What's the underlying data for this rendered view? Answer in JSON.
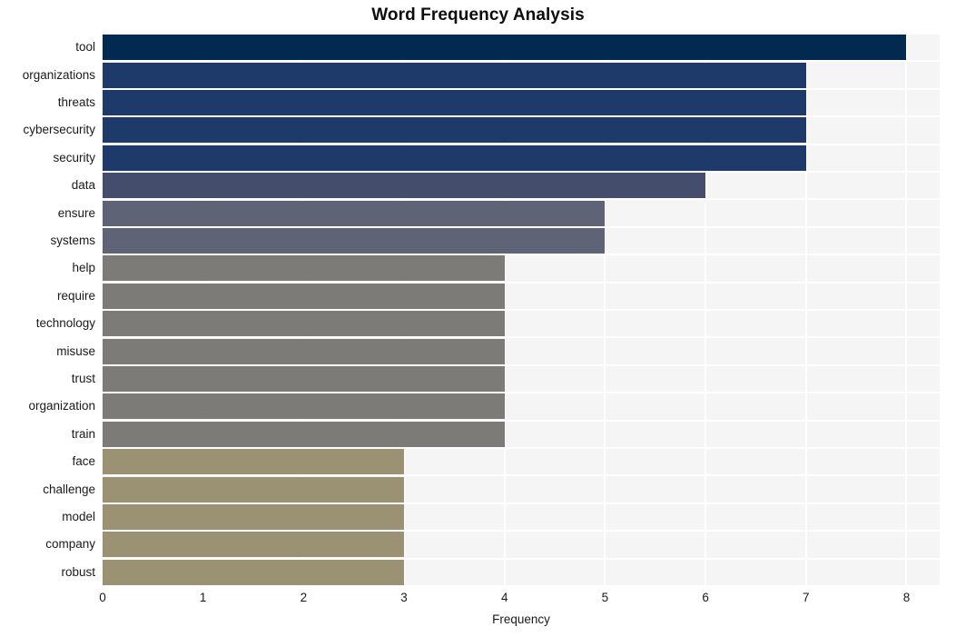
{
  "chart_data": {
    "type": "bar",
    "orientation": "horizontal",
    "title": "Word Frequency Analysis",
    "xlabel": "Frequency",
    "ylabel": "",
    "xlim": [
      0,
      8.33
    ],
    "xticks": [
      "0",
      "1",
      "2",
      "3",
      "4",
      "5",
      "6",
      "7",
      "8"
    ],
    "xtick_values": [
      0,
      1,
      2,
      3,
      4,
      5,
      6,
      7,
      8
    ],
    "grid": true,
    "legend": "none",
    "categories": [
      "tool",
      "organizations",
      "threats",
      "cybersecurity",
      "security",
      "data",
      "ensure",
      "systems",
      "help",
      "require",
      "technology",
      "misuse",
      "trust",
      "organization",
      "train",
      "face",
      "challenge",
      "model",
      "company",
      "robust"
    ],
    "values": [
      8,
      7,
      7,
      7,
      7,
      6,
      5,
      5,
      4,
      4,
      4,
      4,
      4,
      4,
      4,
      3,
      3,
      3,
      3,
      3
    ],
    "bar_colors": [
      "#022950",
      "#1d3a6b",
      "#1d3a6b",
      "#1d3a6b",
      "#1d3a6b",
      "#454d6d",
      "#5e6475",
      "#5e6475",
      "#7c7b78",
      "#7c7b78",
      "#7c7b78",
      "#7c7b78",
      "#7c7b78",
      "#7c7b78",
      "#7c7b78",
      "#9a9273",
      "#9a9273",
      "#9a9273",
      "#9a9273",
      "#9a9273"
    ]
  },
  "style": {
    "figure_background": "#ffffff",
    "panel_background": "#f5f5f6",
    "gridline_color": "#ffffff",
    "tick_label_color": "#1a1a1a",
    "title_color": "#0d0d0d"
  }
}
